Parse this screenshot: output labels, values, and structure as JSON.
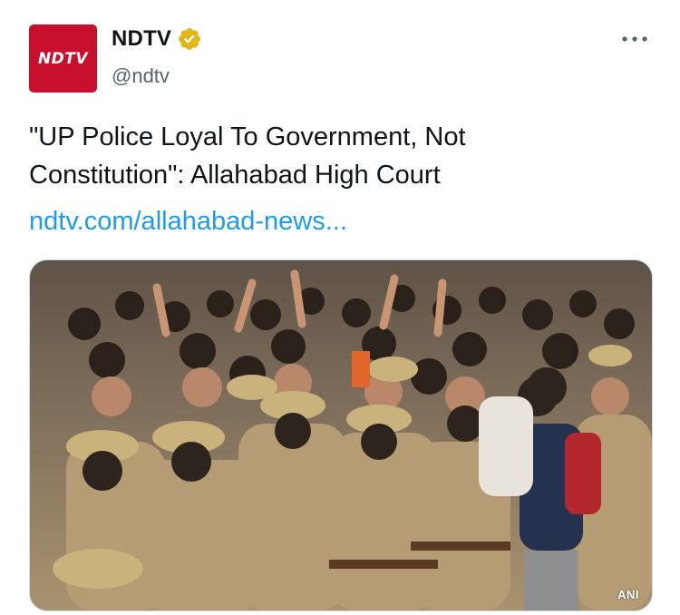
{
  "account": {
    "avatar_text": "NDTV",
    "display_name": "NDTV",
    "handle": "@ndtv",
    "verified_icon": "verified-badge-icon",
    "brand_color": "#c8102e",
    "badge_color": "#e2b719"
  },
  "more_icon": "more-horizontal-icon",
  "tweet": {
    "text": "\"UP Police Loyal To Government, Not Constitution\": Allahabad High Court",
    "link_text": "ndtv.com/allahabad-news...",
    "link_color": "#1d9bf0"
  },
  "media": {
    "watermark": "ANI"
  }
}
